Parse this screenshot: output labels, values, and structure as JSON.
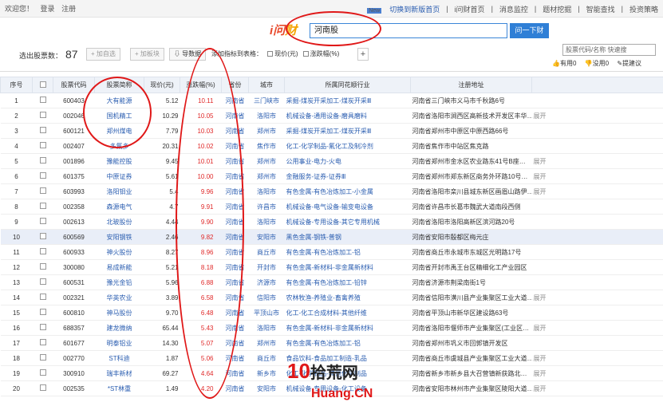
{
  "topbar": {
    "greeting": "欢迎您！",
    "login": "登录",
    "register": "注册",
    "new_badge": "New",
    "switch_new": "切换到新版首页",
    "links": [
      "i问财首页",
      "消息监控",
      "题材挖掘",
      "智能查找",
      "投资策略"
    ]
  },
  "header": {
    "logo_main": "i问",
    "logo_sub": "财",
    "search_value": "河南股",
    "search_button": "问一下财"
  },
  "toolbar": {
    "count_label": "选出股票数：",
    "count_value": "87",
    "add_watch": "+ 加自选",
    "add_block": "+ 加板块",
    "export": "导数据",
    "add_col_label": "添加指标到表格：",
    "opt1": "现价(元)",
    "opt2": "涨跌幅(%)",
    "plus": "+",
    "quick_search_placeholder": "股票代码/名称 快速搜",
    "useful": "有用0",
    "useless": "没用0",
    "report": "提建议"
  },
  "table": {
    "headers": [
      "序号",
      "",
      "股票代码",
      "股票简称",
      "现价(元)",
      "涨跌幅(%)",
      "省份",
      "城市",
      "所属同花顺行业",
      "注册地址",
      ""
    ],
    "rows": [
      [
        "1",
        "600403",
        "大有能源",
        "5.12",
        "10.11",
        "河南省",
        "三门峡市",
        "采掘-煤炭开采加工-煤炭开采Ⅲ",
        "河南省三门峡市义马市千秋路6号",
        ""
      ],
      [
        "2",
        "002046",
        "国机精工",
        "10.29",
        "10.05",
        "河南省",
        "洛阳市",
        "机械设备-通用设备-磨具磨料",
        "河南省洛阳市涧西区高新技术开发区丰华…",
        "展开"
      ],
      [
        "3",
        "600121",
        "郑州煤电",
        "7.79",
        "10.03",
        "河南省",
        "郑州市",
        "采掘-煤炭开采加工-煤炭开采Ⅲ",
        "河南省郑州市中原区中原西路66号",
        ""
      ],
      [
        "4",
        "002407",
        "多氟多",
        "20.31",
        "10.02",
        "河南省",
        "焦作市",
        "化工-化学制品-氟化工及制冷剂",
        "河南省焦作市中站区焦克路",
        ""
      ],
      [
        "5",
        "001896",
        "豫能控股",
        "9.45",
        "10.01",
        "河南省",
        "郑州市",
        "公用事业-电力-火电",
        "河南省郑州市金水区农业路东41号B座…",
        "展开"
      ],
      [
        "6",
        "601375",
        "中原证券",
        "5.61",
        "10.00",
        "河南省",
        "郑州市",
        "金融服务-证券-证券Ⅲ",
        "河南省郑州市郑东新区商务外环路10号…",
        "展开"
      ],
      [
        "7",
        "603993",
        "洛阳钼业",
        "5.4",
        "9.96",
        "河南省",
        "洛阳市",
        "有色金属-有色冶炼加工-小金属",
        "河南省洛阳市栾川县城东新区画眉山路伊…",
        "展开"
      ],
      [
        "8",
        "002358",
        "森源电气",
        "4.7",
        "9.91",
        "河南省",
        "许昌市",
        "机械设备-电气设备-输变电设备",
        "河南省许昌市长葛市魏武大道南段西侧",
        ""
      ],
      [
        "9",
        "002613",
        "北玻股份",
        "4.44",
        "9.90",
        "河南省",
        "洛阳市",
        "机械设备-专用设备-其它专用机械",
        "河南省洛阳市洛阳高新区滨河路20号",
        ""
      ],
      [
        "10",
        "600569",
        "安阳钢铁",
        "2.46",
        "9.82",
        "河南省",
        "安阳市",
        "黑色金属-钢铁-普钢",
        "河南省安阳市殷都区梅元庄",
        ""
      ],
      [
        "11",
        "600933",
        "神火股份",
        "8.27",
        "8.96",
        "河南省",
        "商丘市",
        "有色金属-有色冶炼加工-铝",
        "河南省商丘市永城市东城区光明路17号",
        ""
      ],
      [
        "12",
        "300080",
        "易成新能",
        "5.21",
        "8.18",
        "河南省",
        "开封市",
        "有色金属-新材料-非金属新材料",
        "河南省开封市禹王台区精细化工产业园区",
        ""
      ],
      [
        "13",
        "600531",
        "豫光金铅",
        "5.96",
        "6.88",
        "河南省",
        "济源市",
        "有色金属-有色冶炼加工-铅锌",
        "河南省济源市荆梁南街1号",
        ""
      ],
      [
        "14",
        "002321",
        "华英农业",
        "3.89",
        "6.58",
        "河南省",
        "信阳市",
        "农林牧渔-养殖业-畜禽养殖",
        "河南省信阳市潢川县产业集聚区工业大道…",
        "展开"
      ],
      [
        "15",
        "600810",
        "神马股份",
        "9.70",
        "6.48",
        "河南省",
        "平顶山市",
        "化工-化工合成材料-其他纤维",
        "河南省平顶山市新华区建设路63号",
        ""
      ],
      [
        "16",
        "688357",
        "建龙微纳",
        "65.44",
        "5.43",
        "河南省",
        "洛阳市",
        "有色金属-新材料-非金属新材料",
        "河南省洛阳市偃师市产业集聚区(工业区…",
        "展开"
      ],
      [
        "17",
        "601677",
        "明泰铝业",
        "14.30",
        "5.07",
        "河南省",
        "郑州市",
        "有色金属-有色冶炼加工-铝",
        "河南省郑州市巩义市回郭镇开发区",
        ""
      ],
      [
        "18",
        "002770",
        "ST科迪",
        "1.87",
        "5.06",
        "河南省",
        "商丘市",
        "食品饮料-食品加工制造-乳品",
        "河南省商丘市虞城县产业集聚区工业大道…",
        "展开"
      ],
      [
        "19",
        "300910",
        "瑞丰新材",
        "69.27",
        "4.64",
        "河南省",
        "新乡市",
        "化工-化学制品-其他化学制品",
        "河南省新乡市新乡县大召营镇新获路北…",
        "展开"
      ],
      [
        "20",
        "002535",
        "*ST林重",
        "1.49",
        "4.20",
        "河南省",
        "安阳市",
        "机械设备-专用设备-化工设备",
        "河南省安阳市林州市产业集聚区陵阳大道…",
        "展开"
      ]
    ]
  },
  "watermark": {
    "num": "10",
    "text": "拾荒网",
    "domain": "Huang.CN"
  },
  "colors": {
    "accent": "#2f7fd6",
    "up": "#e02a2a",
    "link": "#2a5db0",
    "annotation": "#e01818"
  }
}
